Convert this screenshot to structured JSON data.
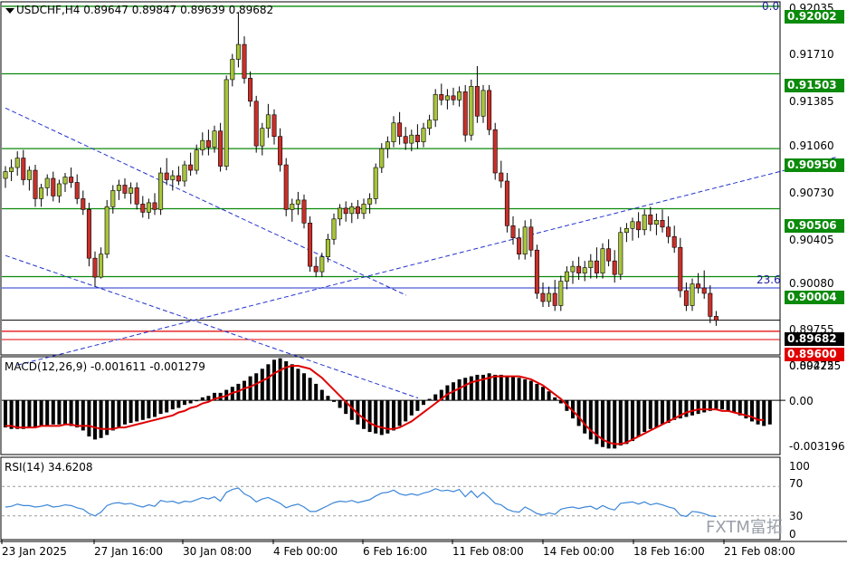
{
  "chart_header": {
    "symbol_tf": "USDCHF,H4",
    "ohlc": "0.89647 0.89847 0.89639 0.89682"
  },
  "price_axis": {
    "labels": [
      "0.92035",
      "0.91710",
      "0.91385",
      "0.91060",
      "0.90730",
      "0.90405",
      "0.90080",
      "0.89755",
      "0.89425"
    ],
    "boxed_levels": [
      {
        "text": "0.92002",
        "color": "#0b8a0b"
      },
      {
        "text": "0.91503",
        "color": "#0b8a0b"
      },
      {
        "text": "0.90950",
        "color": "#0b8a0b"
      },
      {
        "text": "0.90506",
        "color": "#0b8a0b"
      },
      {
        "text": "0.90004",
        "color": "#0b8a0b"
      },
      {
        "text": "0.89682",
        "color": "#000000"
      },
      {
        "text": "0.89600",
        "color": "#e00000"
      }
    ]
  },
  "fibo_labels": {
    "top": "0.0",
    "level": "23.6"
  },
  "macd": {
    "title": "MACD(12,26,9) -0.001611 -0.001279",
    "axis_labels": [
      "0.002725",
      "0.00",
      "-0.003196"
    ]
  },
  "rsi": {
    "title": "RSI(14) 34.6208",
    "axis_labels": [
      "100",
      "70",
      "30",
      "0"
    ]
  },
  "time_axis": [
    "23 Jan 2025",
    "27 Jan 16:00",
    "30 Jan 08:00",
    "4 Feb 00:00",
    "6 Feb 16:00",
    "11 Feb 08:00",
    "14 Feb 00:00",
    "18 Feb 16:00",
    "21 Feb 08:00"
  ],
  "watermark": "FXTM富拓",
  "colors": {
    "bull": "#a8c43a",
    "bear": "#c8302a",
    "support": "#0b8a0b",
    "trend": "#2233cc",
    "signal": "#e00000",
    "rsi": "#3c86d8"
  },
  "chart_data": {
    "type": "candlestick",
    "symbol": "USDCHF",
    "timeframe": "H4",
    "y_range": [
      0.89425,
      0.92035
    ],
    "horizontal_levels": [
      0.92002,
      0.91503,
      0.9095,
      0.90506,
      0.90004,
      0.89682,
      0.896
    ],
    "candles": [
      [
        0.9073,
        0.9082,
        0.9066,
        0.9078
      ],
      [
        0.9078,
        0.9087,
        0.9071,
        0.9081
      ],
      [
        0.9081,
        0.9093,
        0.9075,
        0.9088
      ],
      [
        0.9088,
        0.9094,
        0.9068,
        0.9072
      ],
      [
        0.9072,
        0.9082,
        0.9064,
        0.9079
      ],
      [
        0.9079,
        0.9083,
        0.9052,
        0.9058
      ],
      [
        0.9058,
        0.9069,
        0.9052,
        0.9066
      ],
      [
        0.9066,
        0.9076,
        0.906,
        0.9073
      ],
      [
        0.9073,
        0.9078,
        0.9056,
        0.906
      ],
      [
        0.906,
        0.9072,
        0.9055,
        0.9069
      ],
      [
        0.9069,
        0.9077,
        0.9063,
        0.9074
      ],
      [
        0.9074,
        0.9081,
        0.9066,
        0.907
      ],
      [
        0.907,
        0.9076,
        0.9054,
        0.9058
      ],
      [
        0.9058,
        0.9064,
        0.9046,
        0.905
      ],
      [
        0.905,
        0.9055,
        0.9008,
        0.9014
      ],
      [
        0.9014,
        0.9019,
        0.8993,
        0.9
      ],
      [
        0.9,
        0.9022,
        0.8999,
        0.9017
      ],
      [
        0.9017,
        0.9057,
        0.9014,
        0.9052
      ],
      [
        0.9052,
        0.9068,
        0.9047,
        0.9064
      ],
      [
        0.9064,
        0.9072,
        0.9057,
        0.9068
      ],
      [
        0.9068,
        0.9073,
        0.9058,
        0.9062
      ],
      [
        0.9062,
        0.907,
        0.9054,
        0.9066
      ],
      [
        0.9066,
        0.907,
        0.905,
        0.9054
      ],
      [
        0.9054,
        0.906,
        0.9044,
        0.9048
      ],
      [
        0.9048,
        0.9058,
        0.9043,
        0.9055
      ],
      [
        0.9055,
        0.9062,
        0.9046,
        0.905
      ],
      [
        0.905,
        0.9081,
        0.9046,
        0.9077
      ],
      [
        0.9077,
        0.9088,
        0.9068,
        0.9072
      ],
      [
        0.9072,
        0.9079,
        0.9064,
        0.9075
      ],
      [
        0.9075,
        0.9082,
        0.9068,
        0.9071
      ],
      [
        0.9071,
        0.9086,
        0.9067,
        0.9083
      ],
      [
        0.9083,
        0.9092,
        0.9075,
        0.9079
      ],
      [
        0.9079,
        0.9098,
        0.9076,
        0.9094
      ],
      [
        0.9094,
        0.9107,
        0.909,
        0.9101
      ],
      [
        0.9101,
        0.9109,
        0.909,
        0.9096
      ],
      [
        0.9096,
        0.9112,
        0.9092,
        0.9108
      ],
      [
        0.9108,
        0.9114,
        0.9078,
        0.9082
      ],
      [
        0.9082,
        0.9149,
        0.9079,
        0.9146
      ],
      [
        0.9146,
        0.9165,
        0.9141,
        0.9161
      ],
      [
        0.9161,
        0.9196,
        0.9155,
        0.9172
      ],
      [
        0.9172,
        0.9178,
        0.9143,
        0.9147
      ],
      [
        0.9147,
        0.9152,
        0.9126,
        0.913
      ],
      [
        0.913,
        0.9134,
        0.9092,
        0.9097
      ],
      [
        0.9097,
        0.9114,
        0.909,
        0.911
      ],
      [
        0.911,
        0.9128,
        0.9103,
        0.912
      ],
      [
        0.912,
        0.9124,
        0.9098,
        0.9104
      ],
      [
        0.9104,
        0.911,
        0.9078,
        0.9083
      ],
      [
        0.9083,
        0.9088,
        0.9045,
        0.905
      ],
      [
        0.905,
        0.9058,
        0.9041,
        0.9054
      ],
      [
        0.9054,
        0.9063,
        0.9046,
        0.9057
      ],
      [
        0.9057,
        0.9061,
        0.9036,
        0.904
      ],
      [
        0.904,
        0.9045,
        0.9004,
        0.9008
      ],
      [
        0.9008,
        0.9015,
        0.9,
        0.9004
      ],
      [
        0.9004,
        0.9018,
        0.9,
        0.9015
      ],
      [
        0.9015,
        0.9032,
        0.9011,
        0.9028
      ],
      [
        0.9028,
        0.9047,
        0.9024,
        0.9043
      ],
      [
        0.9043,
        0.9054,
        0.9038,
        0.9051
      ],
      [
        0.9051,
        0.9056,
        0.9041,
        0.9047
      ],
      [
        0.9047,
        0.9055,
        0.904,
        0.9052
      ],
      [
        0.9052,
        0.9057,
        0.9043,
        0.9047
      ],
      [
        0.9047,
        0.9058,
        0.9043,
        0.9054
      ],
      [
        0.9054,
        0.9062,
        0.9047,
        0.9058
      ],
      [
        0.9058,
        0.9084,
        0.9054,
        0.9081
      ],
      [
        0.9081,
        0.9099,
        0.9077,
        0.9095
      ],
      [
        0.9095,
        0.9104,
        0.9088,
        0.91
      ],
      [
        0.91,
        0.9119,
        0.9096,
        0.9114
      ],
      [
        0.9114,
        0.9122,
        0.9098,
        0.9104
      ],
      [
        0.9104,
        0.9111,
        0.9094,
        0.9099
      ],
      [
        0.9099,
        0.9109,
        0.9093,
        0.9105
      ],
      [
        0.9105,
        0.9113,
        0.9095,
        0.91
      ],
      [
        0.91,
        0.9114,
        0.9096,
        0.911
      ],
      [
        0.911,
        0.912,
        0.9105,
        0.9116
      ],
      [
        0.9116,
        0.9139,
        0.9111,
        0.9135
      ],
      [
        0.9135,
        0.9143,
        0.9127,
        0.9131
      ],
      [
        0.9131,
        0.9139,
        0.9124,
        0.9134
      ],
      [
        0.9134,
        0.914,
        0.9127,
        0.9131
      ],
      [
        0.9131,
        0.9141,
        0.9126,
        0.9137
      ],
      [
        0.9137,
        0.9142,
        0.91,
        0.9105
      ],
      [
        0.9105,
        0.9146,
        0.9101,
        0.9141
      ],
      [
        0.9141,
        0.9156,
        0.9114,
        0.9119
      ],
      [
        0.9119,
        0.9142,
        0.9114,
        0.9138
      ],
      [
        0.9138,
        0.9142,
        0.9105,
        0.9109
      ],
      [
        0.9109,
        0.9114,
        0.9072,
        0.9077
      ],
      [
        0.9077,
        0.9086,
        0.9066,
        0.9071
      ],
      [
        0.9071,
        0.9077,
        0.9033,
        0.9038
      ],
      [
        0.9038,
        0.9045,
        0.9024,
        0.9029
      ],
      [
        0.9029,
        0.9036,
        0.9013,
        0.9017
      ],
      [
        0.9017,
        0.9042,
        0.9013,
        0.9037
      ],
      [
        0.9037,
        0.9043,
        0.9015,
        0.902
      ],
      [
        0.902,
        0.9024,
        0.8984,
        0.8988
      ],
      [
        0.8988,
        0.8996,
        0.8978,
        0.8982
      ],
      [
        0.8982,
        0.8993,
        0.8978,
        0.8988
      ],
      [
        0.8988,
        0.8998,
        0.8975,
        0.8979
      ],
      [
        0.8979,
        0.9001,
        0.8975,
        0.8997
      ],
      [
        0.8997,
        0.9008,
        0.8991,
        0.9004
      ],
      [
        0.9004,
        0.9012,
        0.8995,
        0.9008
      ],
      [
        0.9008,
        0.9015,
        0.8998,
        0.9003
      ],
      [
        0.9003,
        0.9012,
        0.8997,
        0.9007
      ],
      [
        0.9007,
        0.9017,
        0.8999,
        0.9012
      ],
      [
        0.9012,
        0.9022,
        0.8999,
        0.9003
      ],
      [
        0.9003,
        0.9025,
        0.8999,
        0.9021
      ],
      [
        0.9021,
        0.9028,
        0.9008,
        0.9012
      ],
      [
        0.9012,
        0.902,
        0.8996,
        0.9002
      ],
      [
        0.9002,
        0.9037,
        0.8998,
        0.9033
      ],
      [
        0.9033,
        0.904,
        0.9026,
        0.9036
      ],
      [
        0.9036,
        0.9044,
        0.9027,
        0.9041
      ],
      [
        0.9041,
        0.9048,
        0.9029,
        0.9035
      ],
      [
        0.9035,
        0.905,
        0.9031,
        0.9046
      ],
      [
        0.9046,
        0.9052,
        0.9034,
        0.9039
      ],
      [
        0.9039,
        0.9047,
        0.9031,
        0.9042
      ],
      [
        0.9042,
        0.905,
        0.9033,
        0.9037
      ],
      [
        0.9037,
        0.9045,
        0.9025,
        0.903
      ],
      [
        0.903,
        0.9038,
        0.9018,
        0.9022
      ],
      [
        0.9022,
        0.9029,
        0.8985,
        0.899
      ],
      [
        0.899,
        0.8996,
        0.8975,
        0.8979
      ],
      [
        0.8979,
        0.8999,
        0.8975,
        0.8995
      ],
      [
        0.8995,
        0.9003,
        0.8988,
        0.8992
      ],
      [
        0.8992,
        0.9005,
        0.8984,
        0.8988
      ],
      [
        0.8988,
        0.8994,
        0.8966,
        0.8971
      ],
      [
        0.8971,
        0.8975,
        0.8964,
        0.8968
      ]
    ],
    "trend_lines": [
      {
        "from": [
          0,
          0.9125
        ],
        "to": [
          58,
          0.9
        ]
      },
      {
        "from": [
          0,
          0.9016
        ],
        "to": [
          60,
          0.8924
        ]
      },
      {
        "from": [
          2,
          0.8935
        ],
        "to": [
          130,
          0.9102
        ]
      }
    ],
    "macd": {
      "histogram": [
        -0.0018,
        -0.0019,
        -0.0019,
        -0.0019,
        -0.0018,
        -0.0018,
        -0.0017,
        -0.0017,
        -0.0016,
        -0.0016,
        -0.0016,
        -0.0017,
        -0.0018,
        -0.002,
        -0.0024,
        -0.0026,
        -0.0025,
        -0.0023,
        -0.002,
        -0.0018,
        -0.0016,
        -0.0015,
        -0.0014,
        -0.0013,
        -0.0012,
        -0.0011,
        -0.0009,
        -0.0008,
        -0.0006,
        -0.0005,
        -0.0003,
        -0.0002,
        0.0,
        0.0002,
        0.0003,
        0.0005,
        0.0005,
        0.0007,
        0.0009,
        0.0011,
        0.0013,
        0.0016,
        0.0018,
        0.0021,
        0.0024,
        0.0027,
        0.0028,
        0.0026,
        0.0024,
        0.0021,
        0.0018,
        0.0015,
        0.0011,
        0.0007,
        0.0003,
        -0.0001,
        -0.0005,
        -0.0009,
        -0.0013,
        -0.0016,
        -0.0019,
        -0.0021,
        -0.0022,
        -0.0023,
        -0.0022,
        -0.002,
        -0.0017,
        -0.0014,
        -0.001,
        -0.0007,
        -0.0003,
        0.0001,
        0.0004,
        0.0007,
        0.001,
        0.0012,
        0.0014,
        0.0015,
        0.0016,
        0.0017,
        0.0017,
        0.0018,
        0.0017,
        0.0017,
        0.0016,
        0.0016,
        0.0015,
        0.0014,
        0.0013,
        0.0011,
        0.0009,
        0.0006,
        0.0002,
        -0.0002,
        -0.0007,
        -0.0012,
        -0.0017,
        -0.0022,
        -0.0026,
        -0.0029,
        -0.0031,
        -0.0032,
        -0.0032,
        -0.003,
        -0.0029,
        -0.0027,
        -0.0024,
        -0.0021,
        -0.0019,
        -0.0018,
        -0.0016,
        -0.0015,
        -0.0013,
        -0.0012,
        -0.0011,
        -0.001,
        -0.0009,
        -0.0008,
        -0.0007,
        -0.0006,
        -0.0006,
        -0.0007,
        -0.0008,
        -0.001,
        -0.0012,
        -0.0014,
        -0.0016,
        -0.0017,
        -0.0016
      ],
      "signal": [
        -0.0017,
        -0.0017,
        -0.0018,
        -0.0018,
        -0.0018,
        -0.0018,
        -0.0017,
        -0.0017,
        -0.0017,
        -0.0017,
        -0.0016,
        -0.0016,
        -0.0017,
        -0.0017,
        -0.0017,
        -0.0018,
        -0.0019,
        -0.0019,
        -0.0019,
        -0.0018,
        -0.0018,
        -0.0017,
        -0.0016,
        -0.0015,
        -0.0014,
        -0.0013,
        -0.0012,
        -0.0011,
        -0.001,
        -0.0008,
        -0.0007,
        -0.0005,
        -0.0004,
        -0.0002,
        -0.0001,
        0.0001,
        0.0002,
        0.0003,
        0.0005,
        0.0006,
        0.0008,
        0.0009,
        0.0011,
        0.0013,
        0.0015,
        0.0018,
        0.002,
        0.0022,
        0.0023,
        0.0023,
        0.0022,
        0.0021,
        0.0018,
        0.0015,
        0.0011,
        0.0007,
        0.0003,
        -0.0001,
        -0.0005,
        -0.0009,
        -0.0012,
        -0.0015,
        -0.0017,
        -0.0018,
        -0.0019,
        -0.0019,
        -0.0018,
        -0.0016,
        -0.0014,
        -0.0011,
        -0.0008,
        -0.0005,
        -0.0002,
        0.0001,
        0.0004,
        0.0006,
        0.0008,
        0.001,
        0.0012,
        0.0013,
        0.0014,
        0.0015,
        0.0016,
        0.0016,
        0.0016,
        0.0016,
        0.0016,
        0.0015,
        0.0014,
        0.0012,
        0.001,
        0.0007,
        0.0004,
        0.0001,
        -0.0003,
        -0.0007,
        -0.0011,
        -0.0016,
        -0.002,
        -0.0023,
        -0.0026,
        -0.0028,
        -0.0029,
        -0.0029,
        -0.0028,
        -0.0026,
        -0.0024,
        -0.0022,
        -0.002,
        -0.0018,
        -0.0016,
        -0.0014,
        -0.0012,
        -0.001,
        -0.0008,
        -0.0007,
        -0.0006,
        -0.0006,
        -0.0006,
        -0.0006,
        -0.0007,
        -0.0007,
        -0.0008,
        -0.0009,
        -0.001,
        -0.0011,
        -0.0013,
        -0.0013
      ],
      "ylim": [
        -0.0036,
        0.0029
      ]
    },
    "rsi": {
      "values": [
        42,
        43,
        46,
        44,
        44,
        42,
        43,
        45,
        42,
        43,
        45,
        44,
        41,
        39,
        33,
        30,
        35,
        44,
        47,
        48,
        46,
        47,
        44,
        42,
        45,
        43,
        51,
        49,
        50,
        47,
        50,
        49,
        52,
        55,
        53,
        56,
        50,
        62,
        66,
        68,
        60,
        56,
        49,
        53,
        55,
        51,
        47,
        41,
        44,
        46,
        42,
        36,
        36,
        40,
        44,
        48,
        50,
        49,
        51,
        48,
        50,
        52,
        57,
        61,
        62,
        65,
        60,
        58,
        60,
        58,
        61,
        63,
        67,
        64,
        65,
        63,
        66,
        56,
        64,
        55,
        62,
        55,
        47,
        45,
        39,
        36,
        35,
        42,
        38,
        33,
        31,
        34,
        32,
        39,
        41,
        42,
        40,
        42,
        43,
        39,
        44,
        40,
        38,
        47,
        48,
        49,
        46,
        49,
        45,
        47,
        45,
        42,
        40,
        31,
        29,
        36,
        35,
        33,
        30,
        29
      ],
      "levels": [
        30,
        70
      ],
      "ylim": [
        0,
        100
      ]
    },
    "xlabels": [
      "23 Jan 2025",
      "27 Jan 16:00",
      "30 Jan 08:00",
      "4 Feb 00:00",
      "6 Feb 16:00",
      "11 Feb 08:00",
      "14 Feb 00:00",
      "18 Feb 16:00",
      "21 Feb 08:00"
    ]
  }
}
